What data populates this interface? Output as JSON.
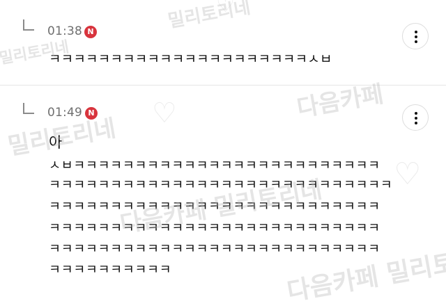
{
  "comments": [
    {
      "time": "01:38",
      "badge": "N",
      "text": "ㅋㅋㅋㅋㅋㅋㅋㅋㅋㅋㅋㅋㅋㅋㅋㅋㅋㅋㅋㅋㅋㅅㅂ"
    },
    {
      "time": "01:49",
      "badge": "N",
      "text_first": "아",
      "text_lines": [
        "ㅅㅂㅋㅋㅋㅋㅋㅋㅋㅋㅋㅋㅋㅋㅋㅋㅋㅋㅋㅋㅋㅋㅋㅋㅋㅋㅋ",
        "ㅋㅋㅋㅋㅋㅋㅋㅋㅋㅋㅋㅋㅋㅋㅋㅋㅋㅋㅋㅋㅋㅋㅋㅋㅋㅋㅋㅋ",
        "ㅋㅋㅋㅋㅋㅋㅋㅋㅋㅋㅋㅋㅋㅋㅋㅋㅋㅋㅋㅋㅋㅋㅋㅋㅋㅋㅋ",
        "ㅋㅋㅋㅋㅋㅋㅋㅋㅋㅋㅋㅋㅋㅋㅋㅋㅋㅋㅋㅋㅋㅋㅋㅋㅋㅋㅋ",
        "ㅋㅋㅋㅋㅋㅋㅋㅋㅋㅋㅋㅋㅋㅋㅋㅋㅋㅋㅋㅋㅋㅋㅋㅋㅋㅋㅋ",
        "ㅋㅋㅋㅋㅋㅋㅋㅋㅋㅋ"
      ]
    }
  ],
  "icons": {
    "reply": "reply-arrow-icon",
    "more": "more-vertical-icon",
    "new": "new-badge-icon"
  },
  "colors": {
    "badge": "#d8343d",
    "time": "#6f6f6f",
    "text": "#111111"
  },
  "watermarks": {
    "a": "밀리토리네",
    "b": "밀리토리네",
    "c": "다음카페",
    "d": "밀리토리네",
    "e": "다음카페 밀리토리네",
    "f": "다음카페 밀리토"
  }
}
